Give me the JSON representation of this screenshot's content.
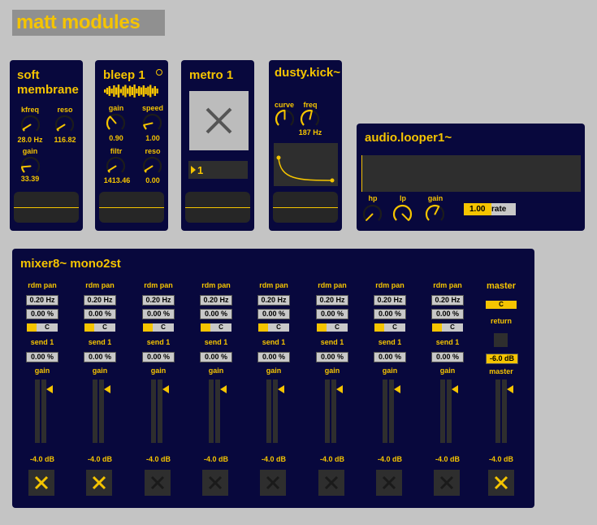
{
  "app_title": "matt modules",
  "soft_membrane": {
    "title": "soft membrane",
    "kfreq_label": "kfreq",
    "kfreq_value": "28.0 Hz",
    "reso_label": "reso",
    "reso_value": "116.82",
    "gain_label": "gain",
    "gain_value": "33.39"
  },
  "bleep": {
    "title": "bleep 1",
    "gain_label": "gain",
    "gain_value": "0.90",
    "speed_label": "speed",
    "speed_value": "1.00",
    "filtr_label": "filtr",
    "filtr_value": "1413.46",
    "reso_label": "reso",
    "reso_value": "0.00"
  },
  "metro": {
    "title": "metro 1",
    "counter_value": "1"
  },
  "dusty_kick": {
    "title": "dusty.kick~",
    "curve_label": "curve",
    "freq_label": "freq",
    "freq_value": "187 Hz"
  },
  "looper": {
    "title": "audio.looper1~",
    "hp_label": "hp",
    "lp_label": "lp",
    "gain_label": "gain",
    "rate_value": "1.00",
    "rate_unit": "rate"
  },
  "mixer": {
    "title": "mixer8~ mono2st",
    "channels": [
      {
        "rdm_pan_label": "rdm pan",
        "freq": "0.20 Hz",
        "pct": "0.00 %",
        "pan": "C",
        "send_label": "send 1",
        "send": "0.00 %",
        "gain_label": "gain",
        "db": "-4.0 dB",
        "muted": true
      },
      {
        "rdm_pan_label": "rdm pan",
        "freq": "0.20 Hz",
        "pct": "0.00 %",
        "pan": "C",
        "send_label": "send 1",
        "send": "0.00 %",
        "gain_label": "gain",
        "db": "-4.0 dB",
        "muted": true
      },
      {
        "rdm_pan_label": "rdm pan",
        "freq": "0.20 Hz",
        "pct": "0.00 %",
        "pan": "C",
        "send_label": "send 1",
        "send": "0.00 %",
        "gain_label": "gain",
        "db": "-4.0 dB",
        "muted": false
      },
      {
        "rdm_pan_label": "rdm pan",
        "freq": "0.20 Hz",
        "pct": "0.00 %",
        "pan": "C",
        "send_label": "send 1",
        "send": "0.00 %",
        "gain_label": "gain",
        "db": "-4.0 dB",
        "muted": false
      },
      {
        "rdm_pan_label": "rdm pan",
        "freq": "0.20 Hz",
        "pct": "0.00 %",
        "pan": "C",
        "send_label": "send 1",
        "send": "0.00 %",
        "gain_label": "gain",
        "db": "-4.0 dB",
        "muted": false
      },
      {
        "rdm_pan_label": "rdm pan",
        "freq": "0.20 Hz",
        "pct": "0.00 %",
        "pan": "C",
        "send_label": "send 1",
        "send": "0.00 %",
        "gain_label": "gain",
        "db": "-4.0 dB",
        "muted": false
      },
      {
        "rdm_pan_label": "rdm pan",
        "freq": "0.20 Hz",
        "pct": "0.00 %",
        "pan": "C",
        "send_label": "send 1",
        "send": "0.00 %",
        "gain_label": "gain",
        "db": "-4.0 dB",
        "muted": false
      },
      {
        "rdm_pan_label": "rdm pan",
        "freq": "0.20 Hz",
        "pct": "0.00 %",
        "pan": "C",
        "send_label": "send 1",
        "send": "0.00 %",
        "gain_label": "gain",
        "db": "-4.0 dB",
        "muted": false
      }
    ],
    "master": {
      "title": "master",
      "pan": "C",
      "return_label": "return",
      "return_db": "-6.0 dB",
      "gain_label": "master",
      "db": "-4.0 dB",
      "muted": true
    }
  },
  "colors": {
    "panel": "#08083d",
    "accent": "#f5c400",
    "background": "#c4c4c4"
  }
}
